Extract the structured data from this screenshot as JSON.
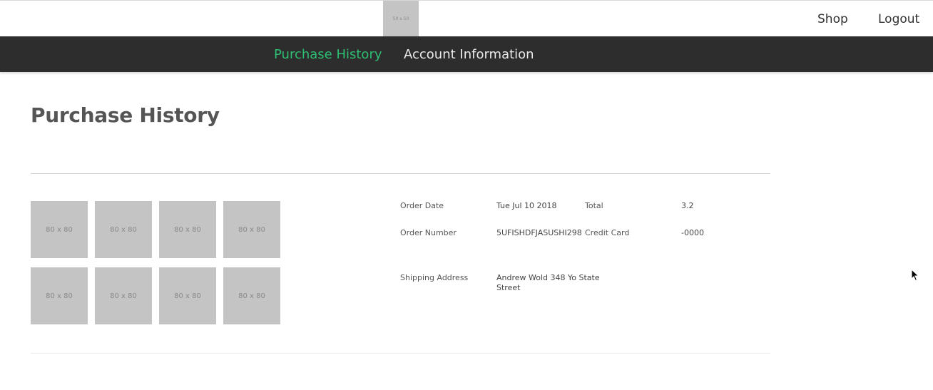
{
  "topbar": {
    "logo_text": "50 x 50",
    "shop_label": "Shop",
    "logout_label": "Logout"
  },
  "nav": {
    "items": [
      {
        "label": "Purchase History",
        "active": true
      },
      {
        "label": "Account Information",
        "active": false
      }
    ],
    "active_color": "#2ebf72"
  },
  "page": {
    "title": "Purchase History"
  },
  "order": {
    "thumbnails": [
      "80 x 80",
      "80 x 80",
      "80 x 80",
      "80 x 80",
      "80 x 80",
      "80 x 80",
      "80 x 80",
      "80 x 80"
    ],
    "order_date_label": "Order Date",
    "order_date": "Tue Jul 10 2018",
    "total_label": "Total",
    "total": "3.2",
    "order_number_label": "Order Number",
    "order_number": "5UFISHDFJASUSHI298",
    "credit_card_label": "Credit Card",
    "credit_card": "-0000",
    "shipping_address_label": "Shipping Address",
    "shipping_address_line1": "Andrew Wold 348 Yo State",
    "shipping_address_line2": "Street"
  }
}
